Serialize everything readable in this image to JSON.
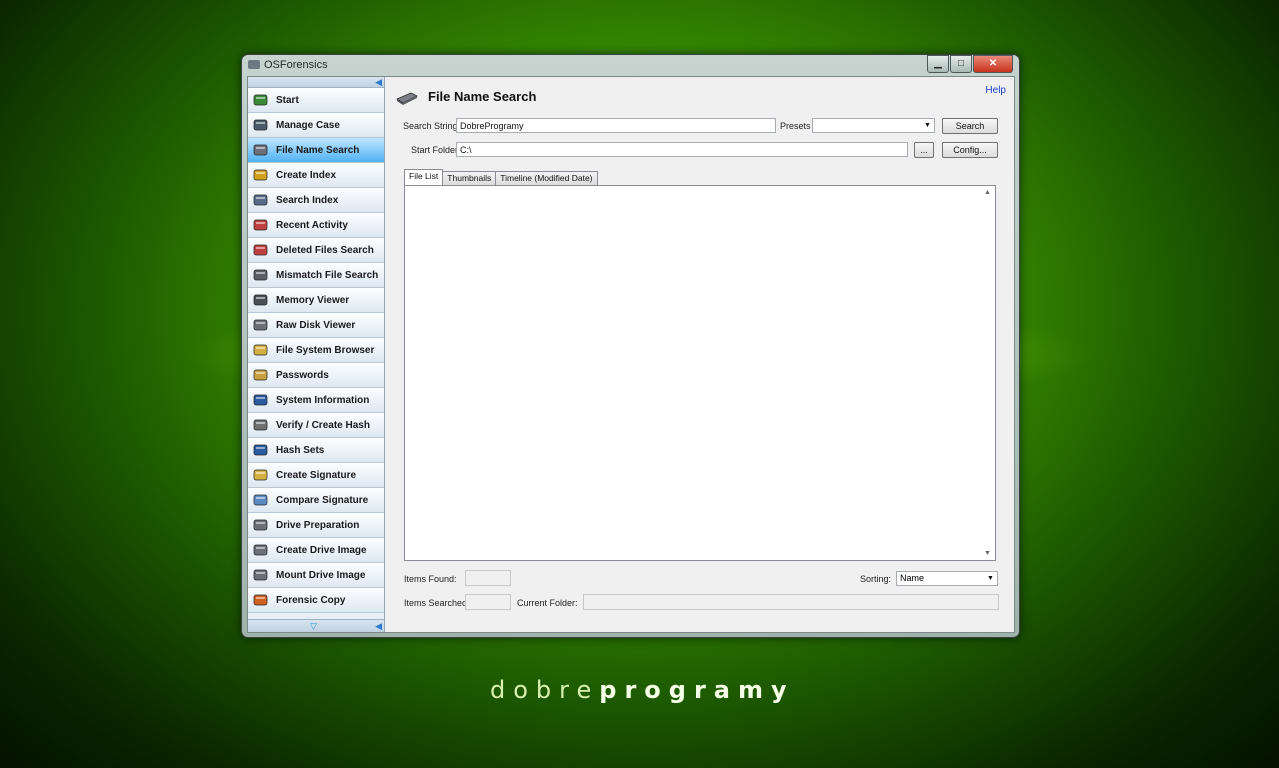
{
  "window": {
    "title": "OSForensics",
    "controls": {
      "minimize": "▁",
      "maximize": "□",
      "close": "✕"
    }
  },
  "sidebar": {
    "items": [
      {
        "label": "Start",
        "icon": "start-icon"
      },
      {
        "label": "Manage Case",
        "icon": "case-icon"
      },
      {
        "label": "File Name Search",
        "icon": "file-search-icon",
        "active": true
      },
      {
        "label": "Create Index",
        "icon": "create-index-icon"
      },
      {
        "label": "Search Index",
        "icon": "search-index-icon"
      },
      {
        "label": "Recent Activity",
        "icon": "recent-activity-icon"
      },
      {
        "label": "Deleted Files Search",
        "icon": "deleted-files-icon"
      },
      {
        "label": "Mismatch File Search",
        "icon": "mismatch-icon"
      },
      {
        "label": "Memory Viewer",
        "icon": "memory-icon"
      },
      {
        "label": "Raw Disk Viewer",
        "icon": "disk-icon"
      },
      {
        "label": "File System Browser",
        "icon": "folder-icon"
      },
      {
        "label": "Passwords",
        "icon": "key-icon"
      },
      {
        "label": "System Information",
        "icon": "system-info-icon"
      },
      {
        "label": "Verify / Create Hash",
        "icon": "hash-icon"
      },
      {
        "label": "Hash Sets",
        "icon": "hash-sets-icon"
      },
      {
        "label": "Create Signature",
        "icon": "create-signature-icon"
      },
      {
        "label": "Compare Signature",
        "icon": "compare-signature-icon"
      },
      {
        "label": "Drive Preparation",
        "icon": "drive-prep-icon"
      },
      {
        "label": "Create Drive Image",
        "icon": "drive-image-icon"
      },
      {
        "label": "Mount Drive Image",
        "icon": "mount-drive-icon"
      },
      {
        "label": "Forensic Copy",
        "icon": "forensic-copy-icon"
      }
    ]
  },
  "header": {
    "title": "File Name Search",
    "help": "Help"
  },
  "search": {
    "string_label": "Search String",
    "string_value": "DobreProgramy",
    "presets_label": "Presets",
    "presets_value": "",
    "search_button": "Search",
    "folder_label": "Start Folder",
    "folder_value": "C:\\",
    "browse_button": "...",
    "config_button": "Config..."
  },
  "tabs": [
    "File List",
    "Thumbnails",
    "Timeline (Modified Date)"
  ],
  "footer": {
    "items_found_label": "Items Found:",
    "items_searched_label": "Items Searched:",
    "current_folder_label": "Current Folder:",
    "sorting_label": "Sorting:",
    "sorting_value": "Name"
  },
  "brand": {
    "light": "dobre",
    "bold": "programy"
  },
  "colors": {
    "active_nav": "#51b2f5",
    "link": "#1a3cc8"
  }
}
